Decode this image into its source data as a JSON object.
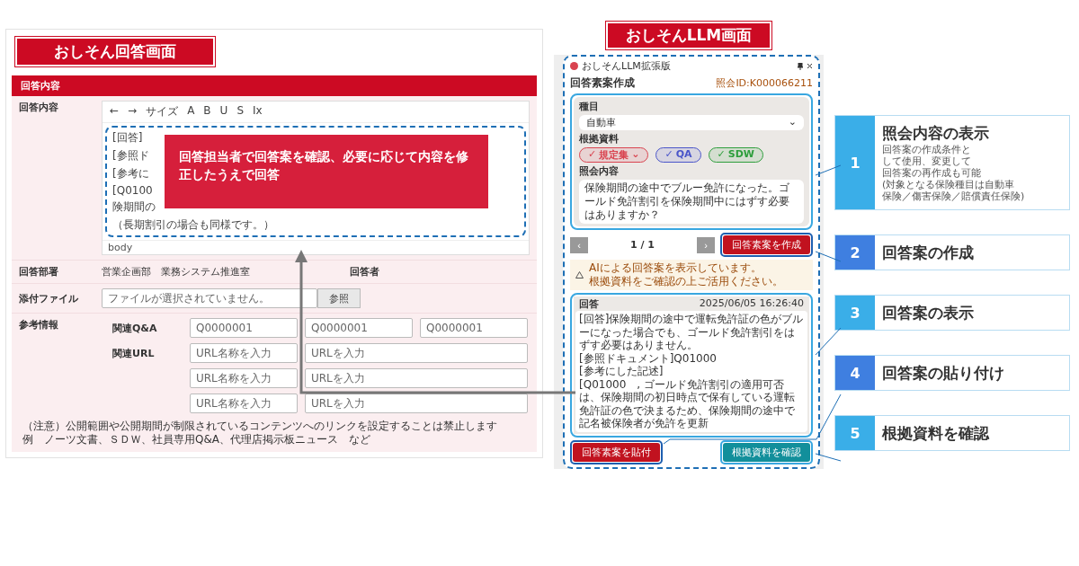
{
  "answer_screen": {
    "title": "おしそん回答画面",
    "section": "回答内容",
    "editor": {
      "label": "回答内容",
      "toolbar": [
        "←",
        "→",
        "サイズ",
        "A",
        "B",
        "U",
        "S",
        "Ix"
      ],
      "lines": [
        "[回答]",
        "[参照ド",
        "[参考に",
        "[Q0100",
        "険期間の",
        "（長期割引の場合も同様です。）"
      ],
      "status": "body",
      "overlay": "回答担当者で回答案を確認、必要に応じて内容を修正したうえで回答"
    },
    "department": {
      "label": "回答部署",
      "value": "営業企画部　業務システム推進室",
      "responder_label": "回答者"
    },
    "attachment": {
      "label": "添付ファイル",
      "placeholder": "ファイルが選択されていません。",
      "button": "参照"
    },
    "reference": {
      "label": "参考情報",
      "qa_label": "関連Q&A",
      "qa_fields": [
        {
          "placeholder": "Q0000001"
        },
        {
          "placeholder": "Q0000001"
        },
        {
          "placeholder": "Q0000001"
        }
      ],
      "url_label": "関連URL",
      "url_rows": [
        {
          "name": {
            "placeholder": "URL名称を入力"
          },
          "url": {
            "placeholder": "URLを入力"
          }
        },
        {
          "name": {
            "placeholder": "URL名称を入力"
          },
          "url": {
            "placeholder": "URLを入力"
          }
        },
        {
          "name": {
            "placeholder": "URL名称を入力"
          },
          "url": {
            "placeholder": "URLを入力"
          }
        }
      ],
      "notes": [
        "（注意）公開範囲や公開期間が制限されているコンテンツへのリンクを設定することは禁止します",
        "例　ノーツ文書、ＳＤＷ、社員専用Q&A、代理店掲示板ニュース　など"
      ]
    }
  },
  "llm_screen": {
    "title": "おしそんLLM画面",
    "window_title": "おしそんLLM拡張版",
    "heading": "回答素案作成",
    "inquiry_id": "照会ID:K000066211",
    "category": {
      "label": "種目",
      "value": "自動車",
      "caret": "⌄"
    },
    "sources": {
      "label": "根拠資料",
      "chips": [
        {
          "check": "✓",
          "label": "規定集",
          "color": "#d9434f",
          "caret": "⌄"
        },
        {
          "check": "✓",
          "label": "QA",
          "color": "#4a55c9"
        },
        {
          "check": "✓",
          "label": "SDW",
          "color": "#2e9e3c"
        }
      ]
    },
    "inquiry": {
      "label": "照会内容",
      "value": "保険期間の途中でブルー免許になった。ゴールド免許割引を保険期間中にはずす必要はありますか？"
    },
    "pager": {
      "prev": "‹",
      "page": "1 / 1",
      "next": "›"
    },
    "create_button": "回答素案を作成",
    "warning": [
      "AIによる回答案を表示しています。",
      "根拠資料をご確認の上ご活用ください。"
    ],
    "answer": {
      "label": "回答",
      "timestamp": "2025/06/05 16:26:40",
      "lines": [
        "[回答]保険期間の途中で運転免許証の色がブルーになった場合でも、ゴールド免許割引をはずす必要はありません。",
        "[参照ドキュメント]Q01000",
        "[参考にした記述]",
        "[Q01000　, ゴールド免許割引の適用可否は、保険期間の初日時点で保有している運転免許証の色で決まるため、保険期間の途中で記名被保険者が免許を更新"
      ]
    },
    "paste_button": "回答素案を貼付",
    "confirm_button": "根拠資料を確認"
  },
  "callouts": [
    {
      "number": "1",
      "title": "照会内容の表示",
      "description": [
        "回答案の作成条件と",
        "して使用、変更して",
        "回答案の再作成も可能",
        "(対象となる保険種目は自動車",
        "保険／傷害保険／賠償責任保険)"
      ],
      "color": "#3aaee8"
    },
    {
      "number": "2",
      "title": "回答案の作成",
      "color": "#3f7fe0"
    },
    {
      "number": "3",
      "title": "回答案の表示",
      "color": "#3aaee8"
    },
    {
      "number": "4",
      "title": "回答案の貼り付け",
      "color": "#3f7fe0"
    },
    {
      "number": "5",
      "title": "根拠資料を確認",
      "color": "#3aaee8"
    }
  ]
}
